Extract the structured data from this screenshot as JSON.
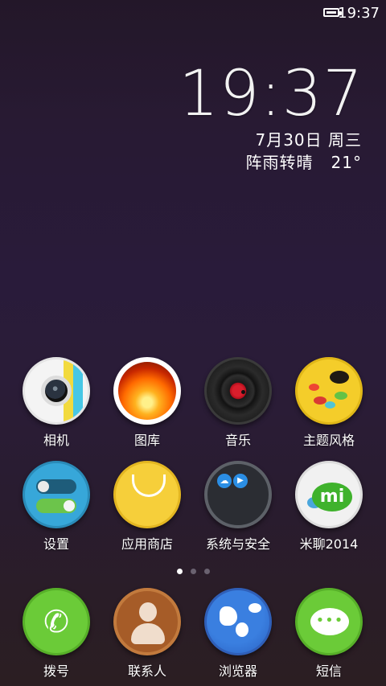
{
  "status_bar": {
    "time": "19:37",
    "battery_icon": "battery-icon"
  },
  "clock": {
    "time": "19:37",
    "date": "7月30日 周三",
    "weather": "阵雨转晴",
    "temperature": "21°"
  },
  "apps_row1": [
    {
      "label": "相机",
      "icon": "camera-icon"
    },
    {
      "label": "图库",
      "icon": "gallery-icon"
    },
    {
      "label": "音乐",
      "icon": "music-icon"
    },
    {
      "label": "主题风格",
      "icon": "theme-icon"
    }
  ],
  "apps_row2": [
    {
      "label": "设置",
      "icon": "settings-icon"
    },
    {
      "label": "应用商店",
      "icon": "store-icon"
    },
    {
      "label": "系统与安全",
      "icon": "security-folder-icon"
    },
    {
      "label": "米聊2014",
      "icon": "miliao-icon"
    }
  ],
  "page_indicator": {
    "pages": 3,
    "active_index": 0
  },
  "dock": [
    {
      "label": "拨号",
      "icon": "phone-icon"
    },
    {
      "label": "联系人",
      "icon": "contacts-icon"
    },
    {
      "label": "浏览器",
      "icon": "browser-icon"
    },
    {
      "label": "短信",
      "icon": "sms-icon"
    }
  ],
  "colors": {
    "wallpaper_top": "#231729",
    "wallpaper_bottom": "#2b1e22",
    "text": "#ffffff"
  }
}
